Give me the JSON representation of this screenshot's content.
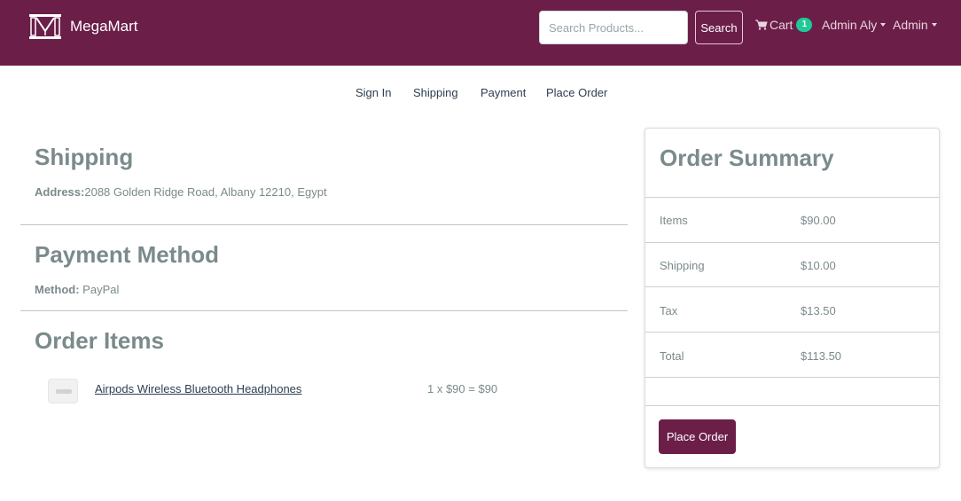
{
  "navbar": {
    "brand_name": "MegaMart",
    "logo_icon": "megamart-logo-icon",
    "search_placeholder": "Search Products...",
    "search_label": "Search",
    "cart_label": "Cart",
    "cart_count": "1",
    "user_menu": "Admin Aly",
    "admin_menu": "Admin",
    "colors": {
      "background": "#6b1e48",
      "badge": "#20c997"
    }
  },
  "steps": [
    "Sign In",
    "Shipping",
    "Payment",
    "Place Order"
  ],
  "shipping": {
    "title": "Shipping",
    "address_label": "Address:",
    "address": "2088 Golden Ridge Road, Albany 12210, Egypt"
  },
  "payment": {
    "title": "Payment Method",
    "method_label": "Method:",
    "method": "PayPal"
  },
  "order_items": {
    "title": "Order Items",
    "items": [
      {
        "name": "Airpods Wireless Bluetooth Headphones",
        "price": "1 x $90 = $90",
        "image_icon": "airpods-thumbnail"
      }
    ]
  },
  "summary": {
    "title": "Order Summary",
    "rows": [
      {
        "label": "Items",
        "value": "$90.00"
      },
      {
        "label": "Shipping",
        "value": "$10.00"
      },
      {
        "label": "Tax",
        "value": "$13.50"
      },
      {
        "label": "Total",
        "value": "$113.50"
      }
    ],
    "button_label": "Place Order",
    "button_color": "#6b1e48"
  }
}
